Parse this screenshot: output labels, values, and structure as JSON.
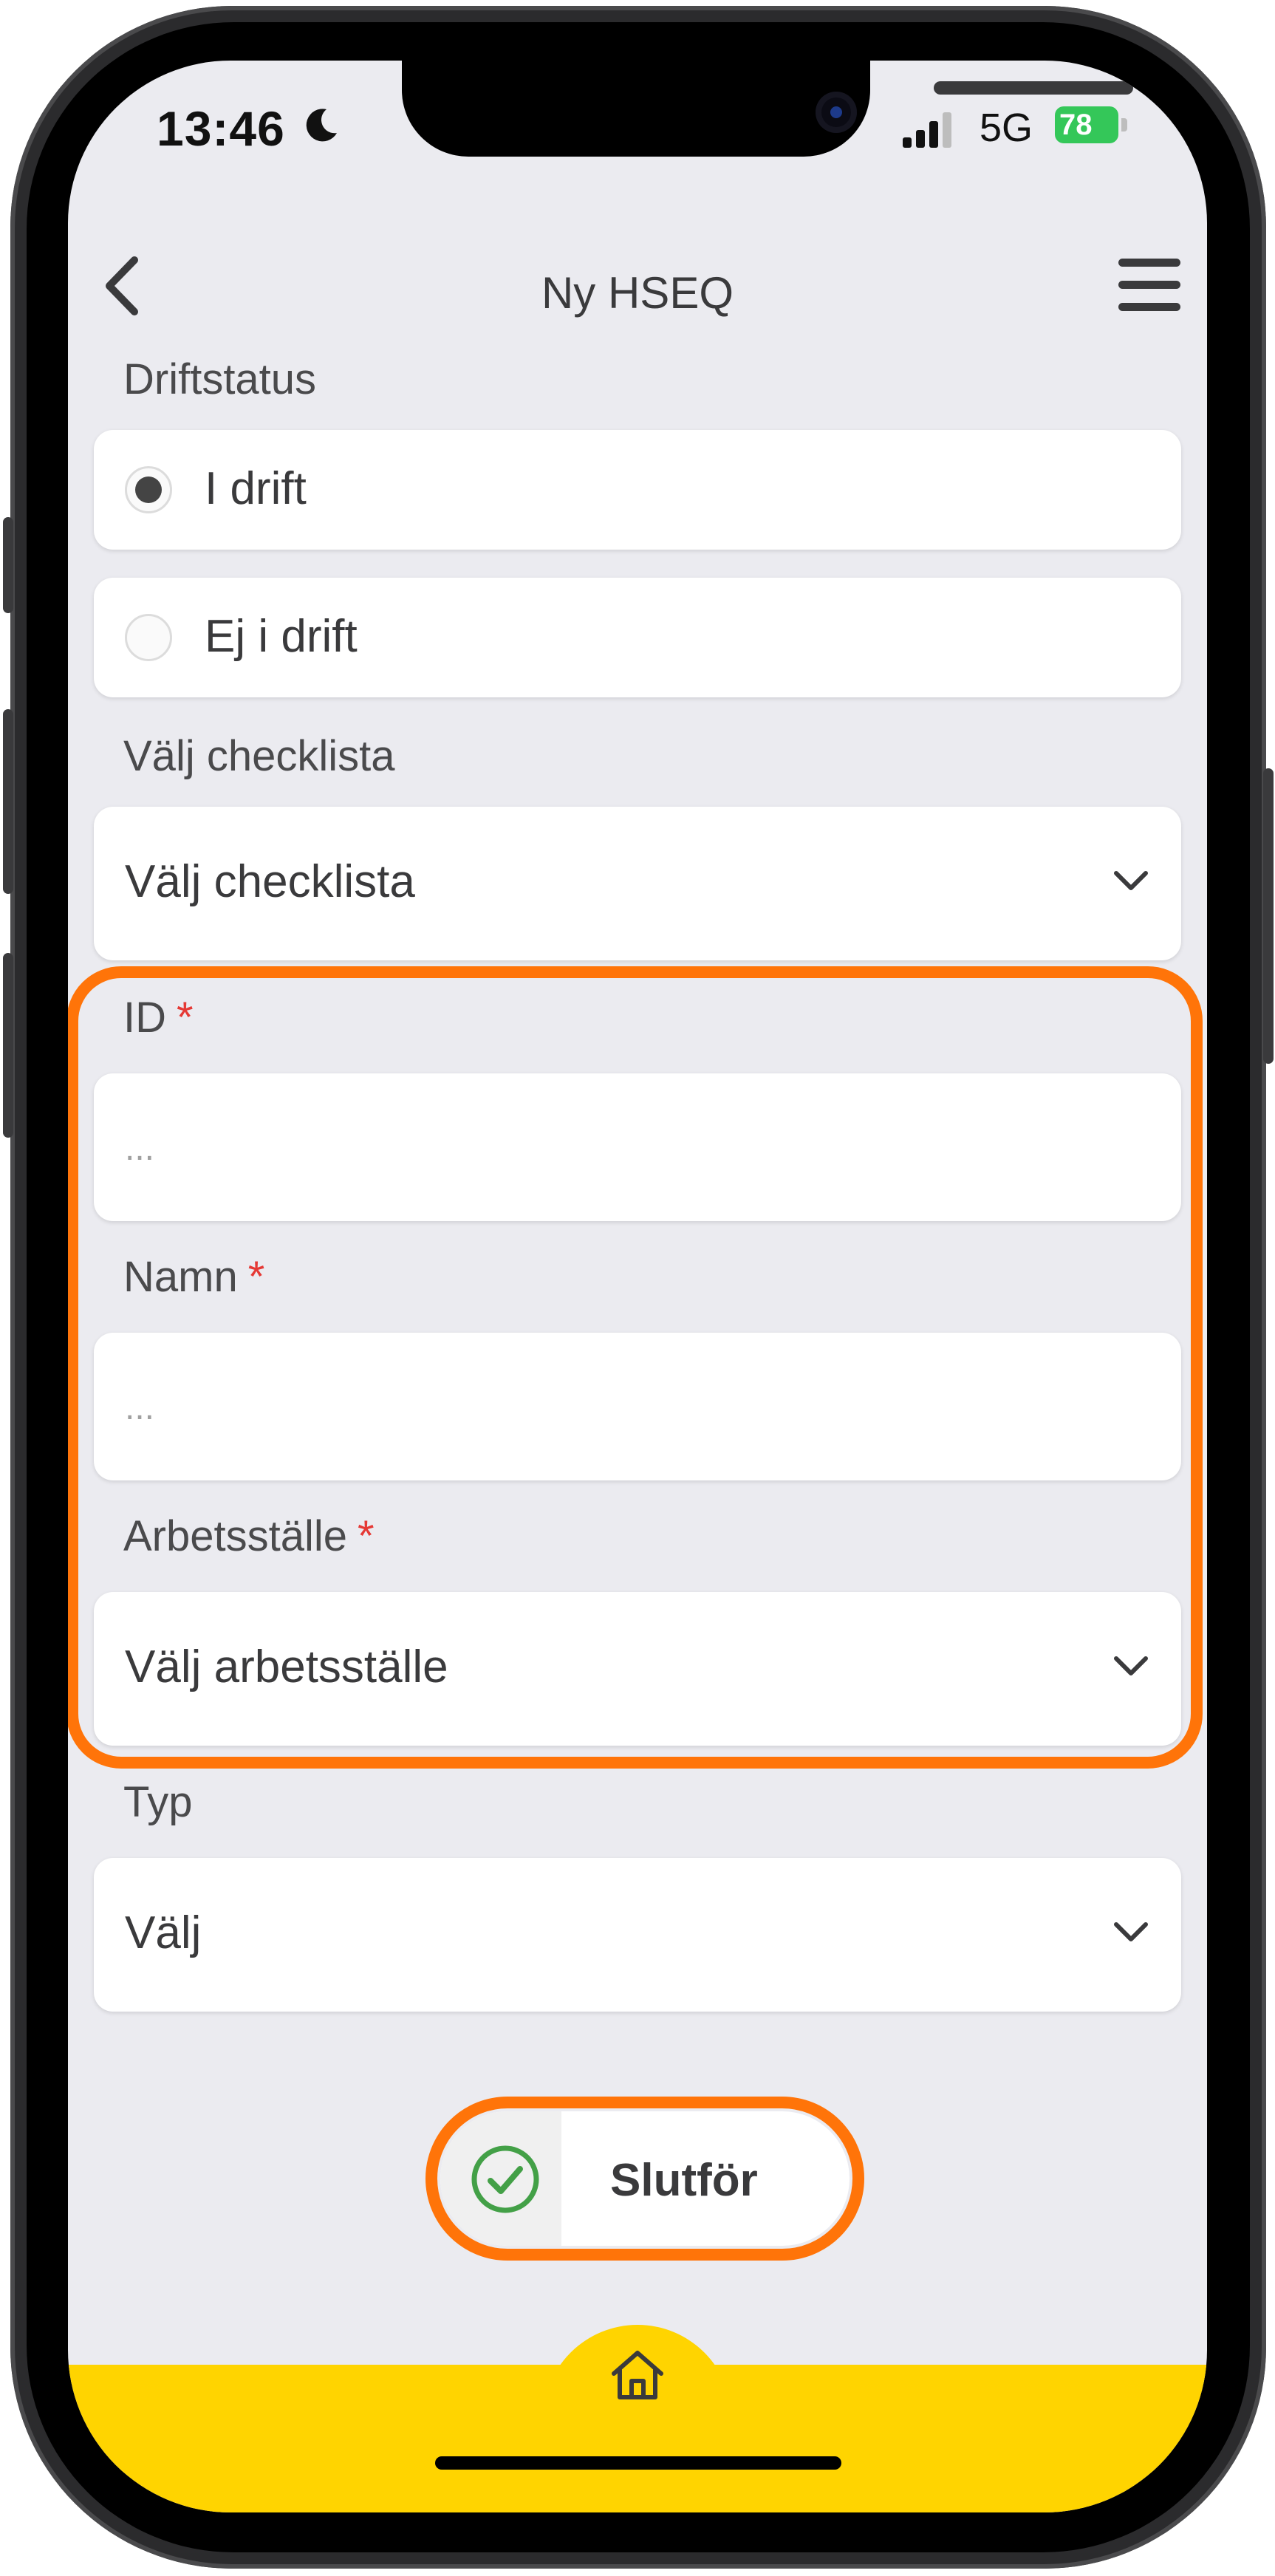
{
  "status": {
    "time": "13:46",
    "network": "5G",
    "battery": "78"
  },
  "header": {
    "title": "Ny HSEQ"
  },
  "form": {
    "driftstatus": {
      "label": "Driftstatus",
      "options": [
        {
          "label": "I drift",
          "selected": true
        },
        {
          "label": "Ej i drift",
          "selected": false
        }
      ]
    },
    "checklista": {
      "label": "Välj checklista",
      "value": "Välj checklista"
    },
    "id": {
      "label": "ID",
      "required_mark": "*",
      "placeholder": "..."
    },
    "namn": {
      "label": "Namn",
      "required_mark": "*",
      "placeholder": "..."
    },
    "arbetsstalle": {
      "label": "Arbetsställe",
      "required_mark": "*",
      "value": "Välj arbetsställe"
    },
    "typ": {
      "label": "Typ",
      "value": "Välj"
    }
  },
  "actions": {
    "finish_label": "Slutför"
  },
  "colors": {
    "highlight": "#ff7409",
    "bottom_bar": "#ffd400",
    "required": "#e53935",
    "battery": "#34c759",
    "check": "#43a047"
  },
  "icons": [
    "back-arrow-icon",
    "hamburger-menu-icon",
    "chevron-down-icon",
    "check-circle-icon",
    "home-icon",
    "moon-icon",
    "signal-icon",
    "battery-icon"
  ]
}
